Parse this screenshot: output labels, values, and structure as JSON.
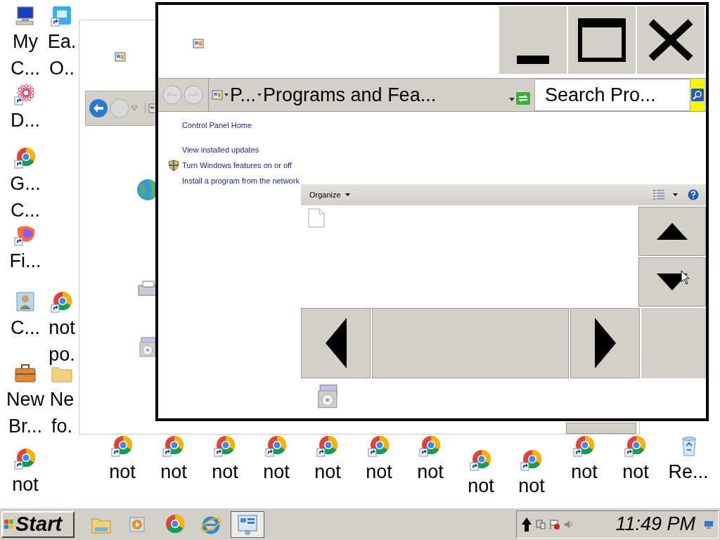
{
  "desktop_icons": [
    {
      "kind": "computer",
      "shortcut": false,
      "label": [
        "My",
        "C..."
      ]
    },
    {
      "kind": "app-tile",
      "shortcut": true,
      "label": [
        "Ea.",
        "O.."
      ]
    },
    {
      "kind": "flower",
      "shortcut": true,
      "label": [
        "D..."
      ]
    },
    {
      "kind": "chrome",
      "shortcut": true,
      "label": [
        "G...",
        "C..."
      ]
    },
    {
      "kind": "firefox",
      "shortcut": true,
      "label": [
        "Fi..."
      ]
    },
    {
      "kind": "contact",
      "shortcut": false,
      "label": [
        "C..."
      ]
    },
    {
      "kind": "chrome",
      "shortcut": true,
      "label": [
        "not",
        "po."
      ]
    },
    {
      "kind": "briefcase",
      "shortcut": false,
      "label": [
        "New",
        "Br..."
      ]
    },
    {
      "kind": "folder",
      "shortcut": false,
      "label": [
        "Ne",
        "fo."
      ]
    },
    {
      "kind": "chrome",
      "shortcut": true,
      "label": [
        "not"
      ]
    },
    {
      "kind": "chrome",
      "shortcut": true,
      "label": [
        "not"
      ]
    },
    {
      "kind": "chrome",
      "shortcut": true,
      "label": [
        "not"
      ]
    },
    {
      "kind": "chrome",
      "shortcut": true,
      "label": [
        "not"
      ]
    },
    {
      "kind": "chrome",
      "shortcut": true,
      "label": [
        "not"
      ]
    },
    {
      "kind": "chrome",
      "shortcut": true,
      "label": [
        "not"
      ]
    },
    {
      "kind": "chrome",
      "shortcut": true,
      "label": [
        "not"
      ]
    },
    {
      "kind": "chrome",
      "shortcut": true,
      "label": [
        "not"
      ]
    },
    {
      "kind": "chrome",
      "shortcut": true,
      "label": [
        "not"
      ]
    },
    {
      "kind": "chrome",
      "shortcut": true,
      "label": [
        "not"
      ]
    },
    {
      "kind": "chrome",
      "shortcut": true,
      "label": [
        "not"
      ]
    },
    {
      "kind": "chrome",
      "shortcut": true,
      "label": [
        "not"
      ]
    },
    {
      "kind": "recycle-bin",
      "shortcut": false,
      "label": [
        "Re..."
      ]
    }
  ],
  "main_window": {
    "address_bar": {
      "crumbs": [
        "P...",
        "Programs and Fea..."
      ]
    },
    "search": {
      "placeholder": "Search Pro..."
    },
    "tasks": [
      {
        "kind": "plain",
        "label": "Control Panel Home"
      },
      {
        "kind": "plain",
        "label": "View installed updates"
      },
      {
        "kind": "shield",
        "label": "Turn Windows features on or off"
      },
      {
        "kind": "plain",
        "label": "Install a program from the network"
      }
    ],
    "toolbar": {
      "organize": "Organize"
    }
  },
  "taskbar": {
    "start": "Start",
    "buttons": [
      {
        "kind": "explorer",
        "selected": false
      },
      {
        "kind": "media",
        "selected": false
      },
      {
        "kind": "chrome",
        "selected": false
      },
      {
        "kind": "ie",
        "selected": false
      },
      {
        "kind": "control-panel",
        "selected": true
      }
    ],
    "clock": "11:49 PM"
  }
}
